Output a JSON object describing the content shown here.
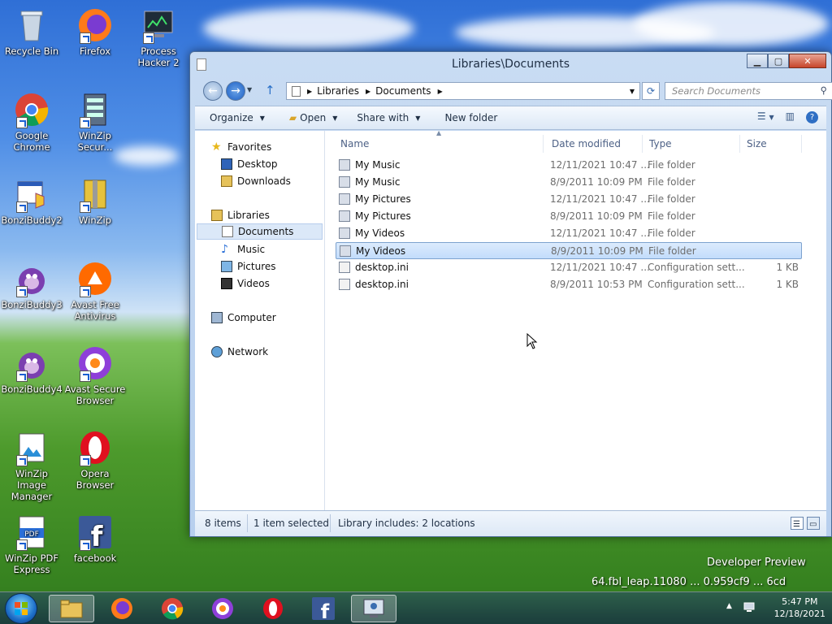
{
  "desktop": {
    "icons": [
      {
        "label": "Recycle Bin"
      },
      {
        "label": "Firefox"
      },
      {
        "label": "Process Hacker 2"
      },
      {
        "label": "Google Chrome"
      },
      {
        "label": "WinZip Secur..."
      },
      {
        "label": "BonziBuddy2"
      },
      {
        "label": "WinZip"
      },
      {
        "label": "BonziBuddy3"
      },
      {
        "label": "Avast Free Antivirus"
      },
      {
        "label": "BonziBuddy4"
      },
      {
        "label": "Avast Secure Browser"
      },
      {
        "label": "WinZip Image Manager"
      },
      {
        "label": "Opera Browser"
      },
      {
        "label": "WinZip PDF Express"
      },
      {
        "label": "facebook"
      }
    ],
    "watermark_line1": "Developer Preview",
    "watermark_line2": "64.fbl_leap.11080 ... 0.959cf9 ... 6cd"
  },
  "window": {
    "title": "Libraries\\Documents",
    "address": {
      "crumbs": [
        "Libraries",
        "Documents"
      ]
    },
    "search_placeholder": "Search Documents",
    "toolbar": {
      "organize": "Organize",
      "open": "Open",
      "share_with": "Share with",
      "new_folder": "New folder"
    },
    "nav": {
      "favorites": "Favorites",
      "desktop": "Desktop",
      "downloads": "Downloads",
      "libraries": "Libraries",
      "documents": "Documents",
      "music": "Music",
      "pictures": "Pictures",
      "videos": "Videos",
      "computer": "Computer",
      "network": "Network"
    },
    "columns": {
      "name": "Name",
      "date": "Date modified",
      "type": "Type",
      "size": "Size"
    },
    "files": [
      {
        "name": "My Music",
        "date": "12/11/2021 10:47 ...",
        "type": "File folder",
        "size": ""
      },
      {
        "name": "My Music",
        "date": "8/9/2011 10:09 PM",
        "type": "File folder",
        "size": ""
      },
      {
        "name": "My Pictures",
        "date": "12/11/2021 10:47 ...",
        "type": "File folder",
        "size": ""
      },
      {
        "name": "My Pictures",
        "date": "8/9/2011 10:09 PM",
        "type": "File folder",
        "size": ""
      },
      {
        "name": "My Videos",
        "date": "12/11/2021 10:47 ...",
        "type": "File folder",
        "size": ""
      },
      {
        "name": "My Videos",
        "date": "8/9/2011 10:09 PM",
        "type": "File folder",
        "size": ""
      },
      {
        "name": "desktop.ini",
        "date": "12/11/2021 10:47 ...",
        "type": "Configuration sett...",
        "size": "1 KB"
      },
      {
        "name": "desktop.ini",
        "date": "8/9/2011 10:53 PM",
        "type": "Configuration sett...",
        "size": "1 KB"
      }
    ],
    "status": {
      "items": "8 items",
      "selected": "1 item selected",
      "library": "Library includes: 2 locations"
    }
  },
  "taskbar": {
    "time": "5:47 PM",
    "date": "12/18/2021"
  }
}
